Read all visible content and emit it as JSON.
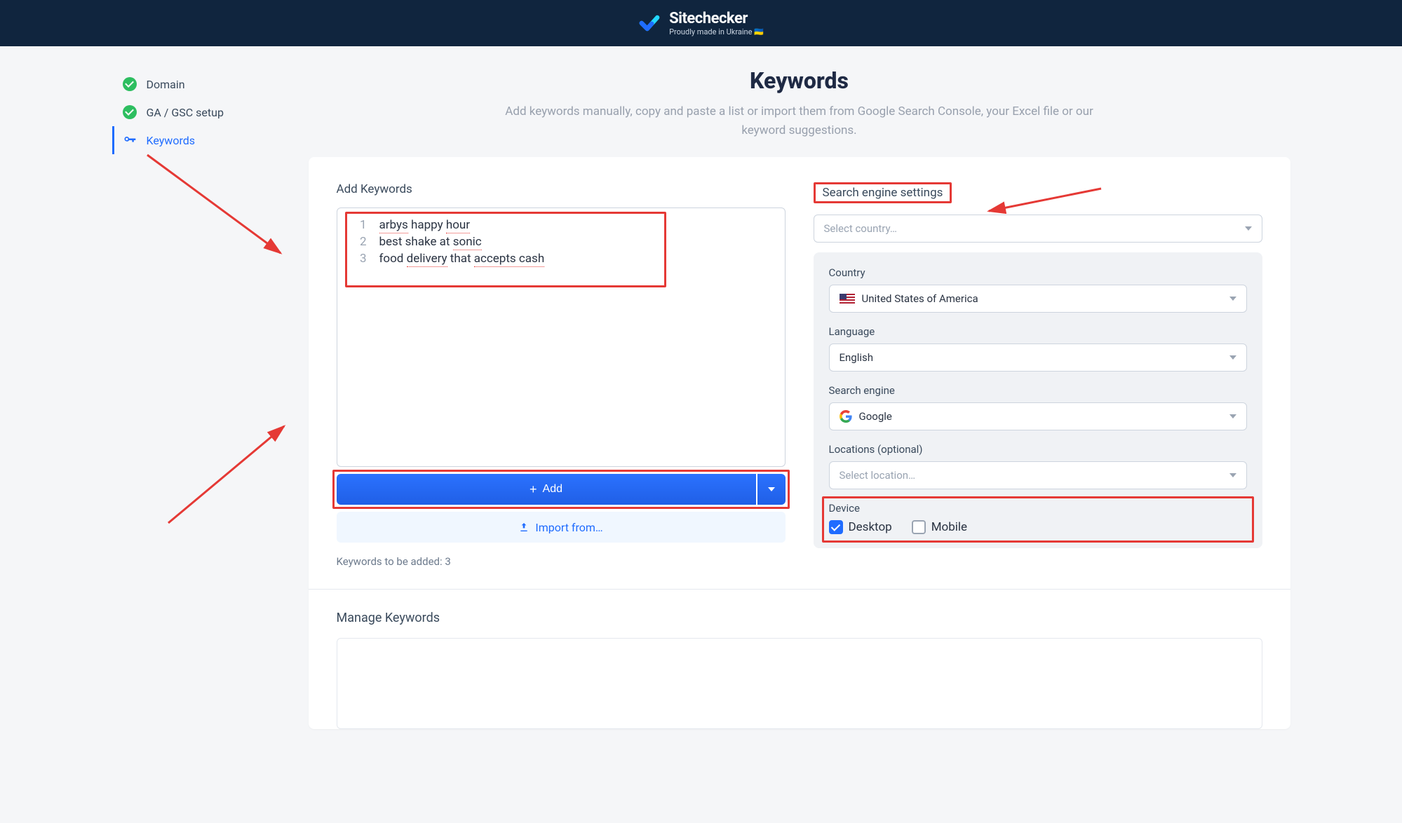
{
  "brand": {
    "name": "Sitechecker",
    "tagline_prefix": "Proudly made in Ukraine ",
    "flag": "🇺🇦"
  },
  "sidebar": {
    "items": [
      {
        "label": "Domain"
      },
      {
        "label": "GA / GSC setup"
      },
      {
        "label": "Keywords"
      }
    ]
  },
  "page": {
    "title": "Keywords",
    "subtitle": "Add keywords manually, copy and paste a list or import them from Google Search Console, your Excel file or our keyword suggestions."
  },
  "add": {
    "title": "Add Keywords",
    "lines": [
      {
        "num": "1",
        "plain0": "arbys",
        "u0": " happy ",
        "plain1": "hour",
        "u_last": "hour"
      },
      {
        "num": "2",
        "plain0": "best shake at ",
        "u0": "sonic"
      },
      {
        "num": "3",
        "plain0": "food ",
        "u0": "delivery",
        "plain1": " that ",
        "u1": "accepts cash"
      }
    ],
    "button": "Add",
    "import": "Import from…",
    "count": "Keywords to be added: 3"
  },
  "settings": {
    "title": "Search engine settings",
    "country_select_placeholder": "Select country…",
    "country_label": "Country",
    "country_value": "United States of America",
    "language_label": "Language",
    "language_value": "English",
    "engine_label": "Search engine",
    "engine_value": "Google",
    "locations_label": "Locations (optional)",
    "locations_placeholder": "Select location…",
    "device_label": "Device",
    "device_desktop": "Desktop",
    "device_mobile": "Mobile"
  },
  "manage": {
    "title": "Manage Keywords"
  }
}
